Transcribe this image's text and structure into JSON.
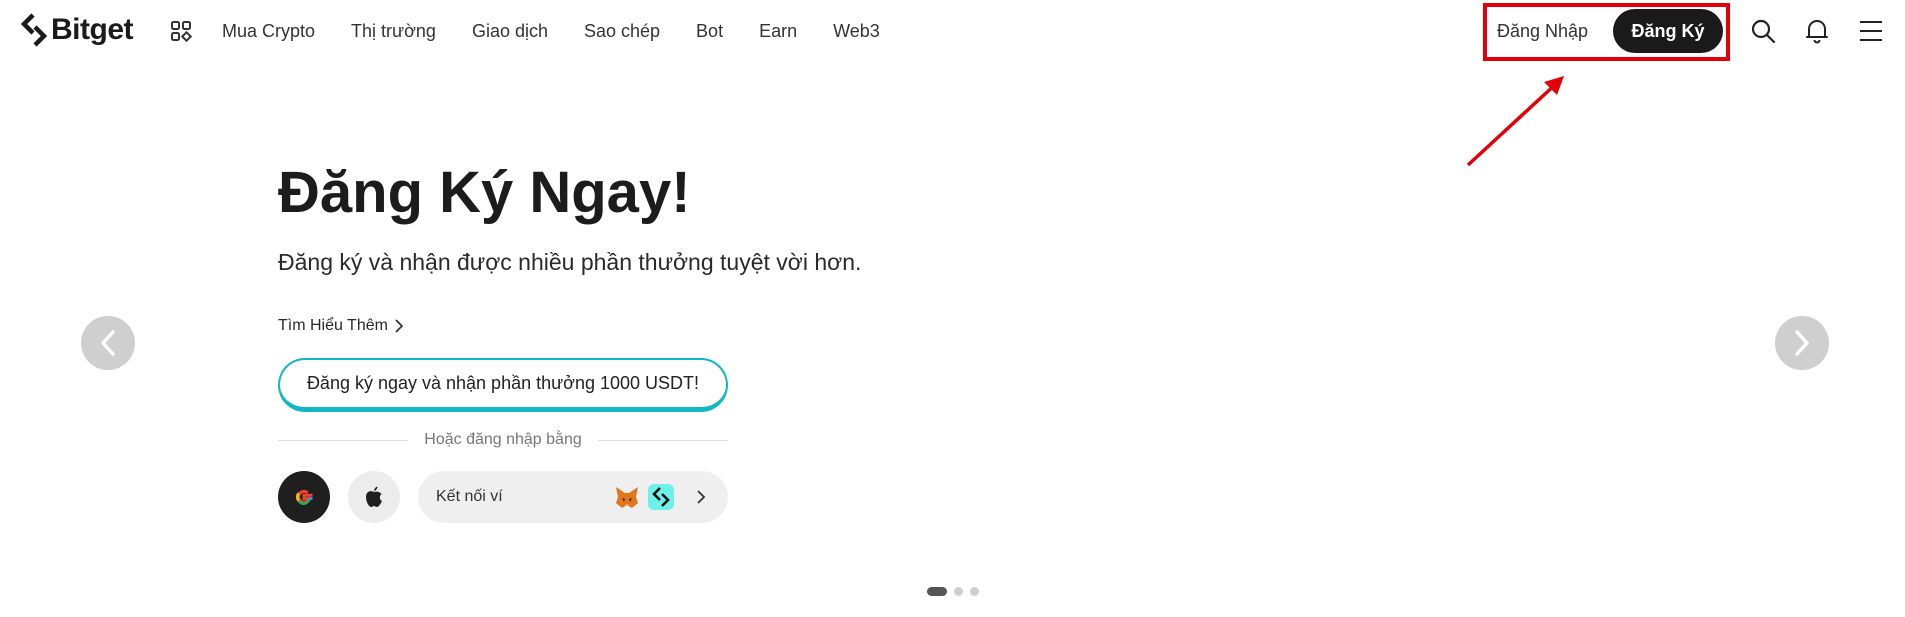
{
  "header": {
    "logo_text": "Bitget",
    "nav": [
      "Mua Crypto",
      "Thị trường",
      "Giao dịch",
      "Sao chép",
      "Bot",
      "Earn",
      "Web3"
    ],
    "login_label": "Đăng Nhập",
    "signup_label": "Đăng Ký",
    "icons": [
      "apps-grid-icon",
      "search-icon",
      "bell-icon",
      "menu-icon"
    ]
  },
  "hero": {
    "title": "Đăng Ký Ngay!",
    "subtitle": "Đăng ký và nhận được nhiều phần thưởng tuyệt vời hơn.",
    "learn_more": "Tìm Hiểu Thêm",
    "cta": "Đăng ký ngay và nhận phần thưởng 1000 USDT!",
    "divider_text": "Hoặc đăng nhập bằng",
    "wallet_label": "Kết nối ví",
    "social_icons": [
      "google-icon",
      "apple-icon",
      "metamask-fox-icon",
      "bitget-wallet-icon"
    ]
  },
  "carousel": {
    "slide_count": 3,
    "active_index": 0
  },
  "colors": {
    "accent": "#12b6c4",
    "primary_button": "#1a1a1a",
    "highlight": "#e3000b",
    "carousel_button": "#cfcfcf"
  }
}
